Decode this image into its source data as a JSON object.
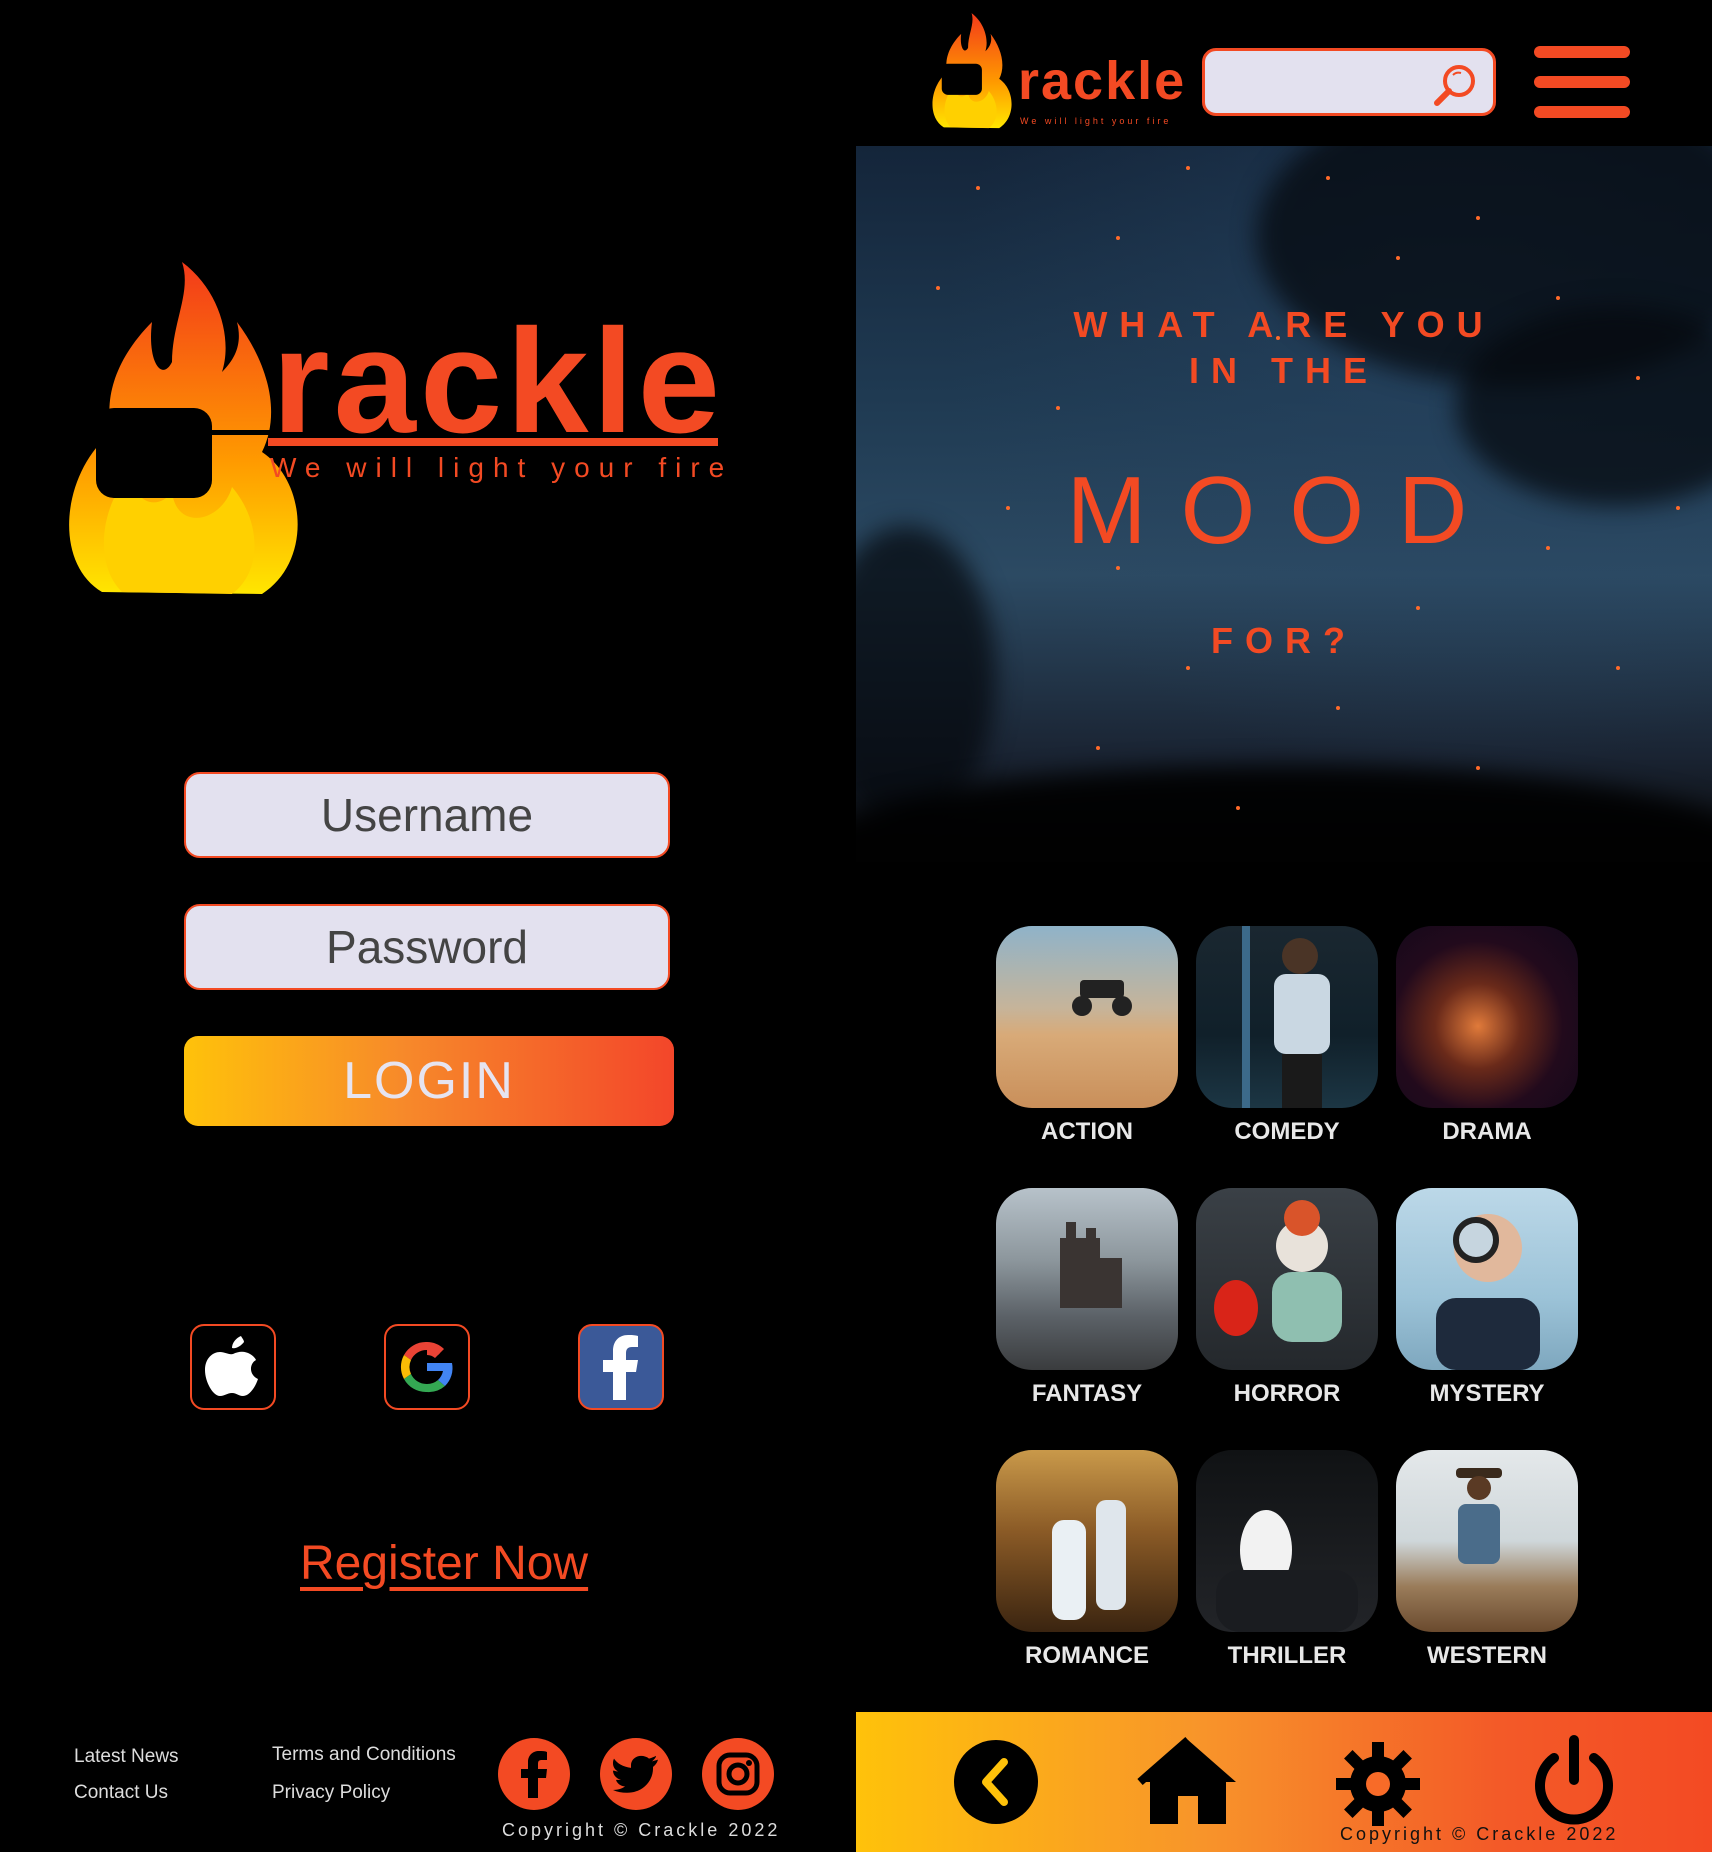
{
  "brand": {
    "name": "rackle",
    "tagline": "We will light your fire",
    "accent": "#f34a23",
    "gradient_start": "#ffc20a"
  },
  "login": {
    "username_placeholder": "Username",
    "password_placeholder": "Password",
    "login_label": "LOGIN",
    "social": [
      {
        "name": "apple-icon"
      },
      {
        "name": "google-icon"
      },
      {
        "name": "facebook-icon"
      }
    ],
    "register_label": "Register Now"
  },
  "footer": {
    "links": [
      "Latest News",
      "Contact Us",
      "Terms and Conditions",
      "Privacy Policy"
    ],
    "social_icons": [
      "facebook-icon",
      "twitter-icon",
      "instagram-icon"
    ],
    "copyright": "Copyright © Crackle 2022"
  },
  "header": {
    "search_icon": "search-icon",
    "menu_icon": "hamburger-menu-icon"
  },
  "hero": {
    "line1": "WHAT ARE YOU",
    "line2": "IN THE",
    "line3": "MOOD",
    "line4": "FOR?"
  },
  "genres": [
    {
      "label": "ACTION"
    },
    {
      "label": "COMEDY"
    },
    {
      "label": "DRAMA"
    },
    {
      "label": "FANTASY"
    },
    {
      "label": "HORROR"
    },
    {
      "label": "MYSTERY"
    },
    {
      "label": "ROMANCE"
    },
    {
      "label": "THRILLER"
    },
    {
      "label": "WESTERN"
    }
  ],
  "bottom_nav": {
    "icons": [
      "back-icon",
      "home-icon",
      "settings-icon",
      "power-icon"
    ],
    "copyright": "Copyright © Crackle 2022"
  }
}
